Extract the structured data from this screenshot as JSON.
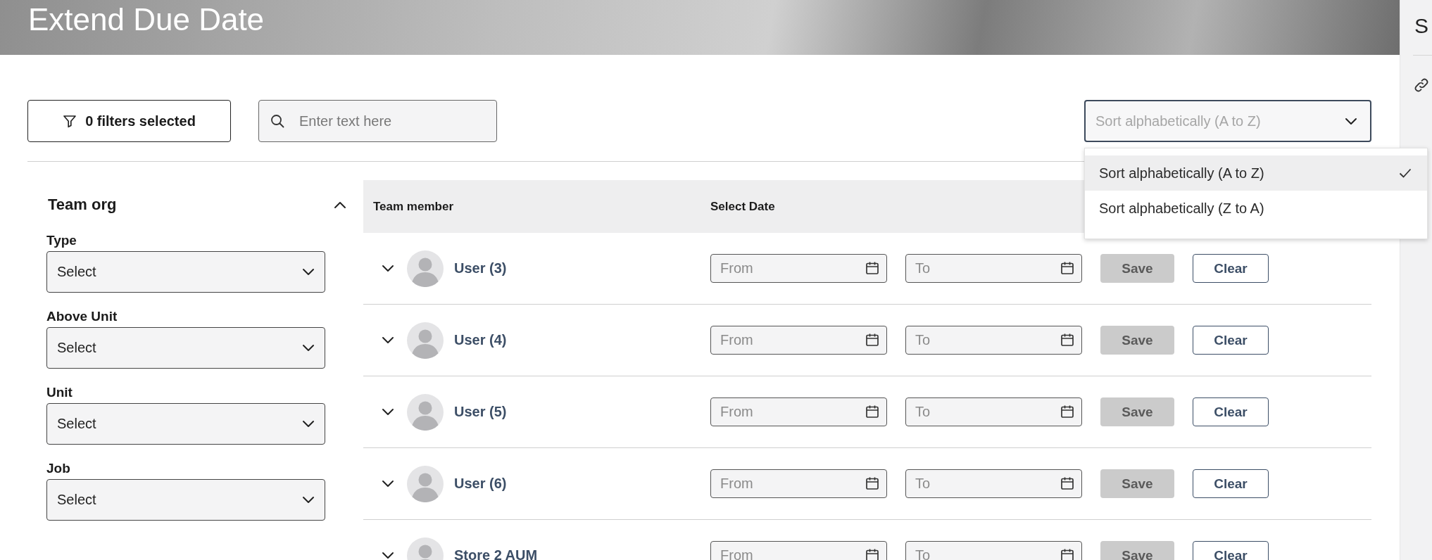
{
  "header": {
    "title": "Extend Due Date"
  },
  "toolbar": {
    "filter_button": "0 filters selected",
    "search": {
      "placeholder": "Enter text here"
    },
    "sort": {
      "value": "Sort alphabetically (A to Z)",
      "expanded": true,
      "options": [
        {
          "label": "Sort alphabetically (A to Z)",
          "selected": true
        },
        {
          "label": "Sort alphabetically (Z to A)",
          "selected": false
        }
      ]
    }
  },
  "filters": {
    "title": "Team org",
    "expanded": true,
    "fields": [
      {
        "label": "Type",
        "value": "Select"
      },
      {
        "label": "Above Unit",
        "value": "Select"
      },
      {
        "label": "Unit",
        "value": "Select"
      },
      {
        "label": "Job",
        "value": "Select"
      }
    ]
  },
  "table": {
    "columns": [
      "Team member",
      "Select Date"
    ],
    "rows": [
      {
        "name": "User (3)",
        "expanded": false,
        "from": {
          "placeholder": "From"
        },
        "to": {
          "placeholder": "To"
        },
        "save": {
          "label": "Save",
          "disabled": true
        },
        "clear": "Clear"
      },
      {
        "name": "User (4)",
        "expanded": false,
        "from": {
          "placeholder": "From"
        },
        "to": {
          "placeholder": "To"
        },
        "save": {
          "label": "Save",
          "disabled": true
        },
        "clear": "Clear"
      },
      {
        "name": "User (5)",
        "expanded": false,
        "from": {
          "placeholder": "From"
        },
        "to": {
          "placeholder": "To"
        },
        "save": {
          "label": "Save",
          "disabled": true
        },
        "clear": "Clear"
      },
      {
        "name": "User (6)",
        "expanded": false,
        "from": {
          "placeholder": "From"
        },
        "to": {
          "placeholder": "To"
        },
        "save": {
          "label": "Save",
          "disabled": true
        },
        "clear": "Clear"
      },
      {
        "name": "Store 2 AUM",
        "expanded": false,
        "from": {
          "placeholder": "From"
        },
        "to": {
          "placeholder": "To"
        },
        "save": {
          "label": "Save",
          "disabled": true
        },
        "clear": "Clear"
      }
    ]
  },
  "side_panel": {
    "title": "S"
  }
}
